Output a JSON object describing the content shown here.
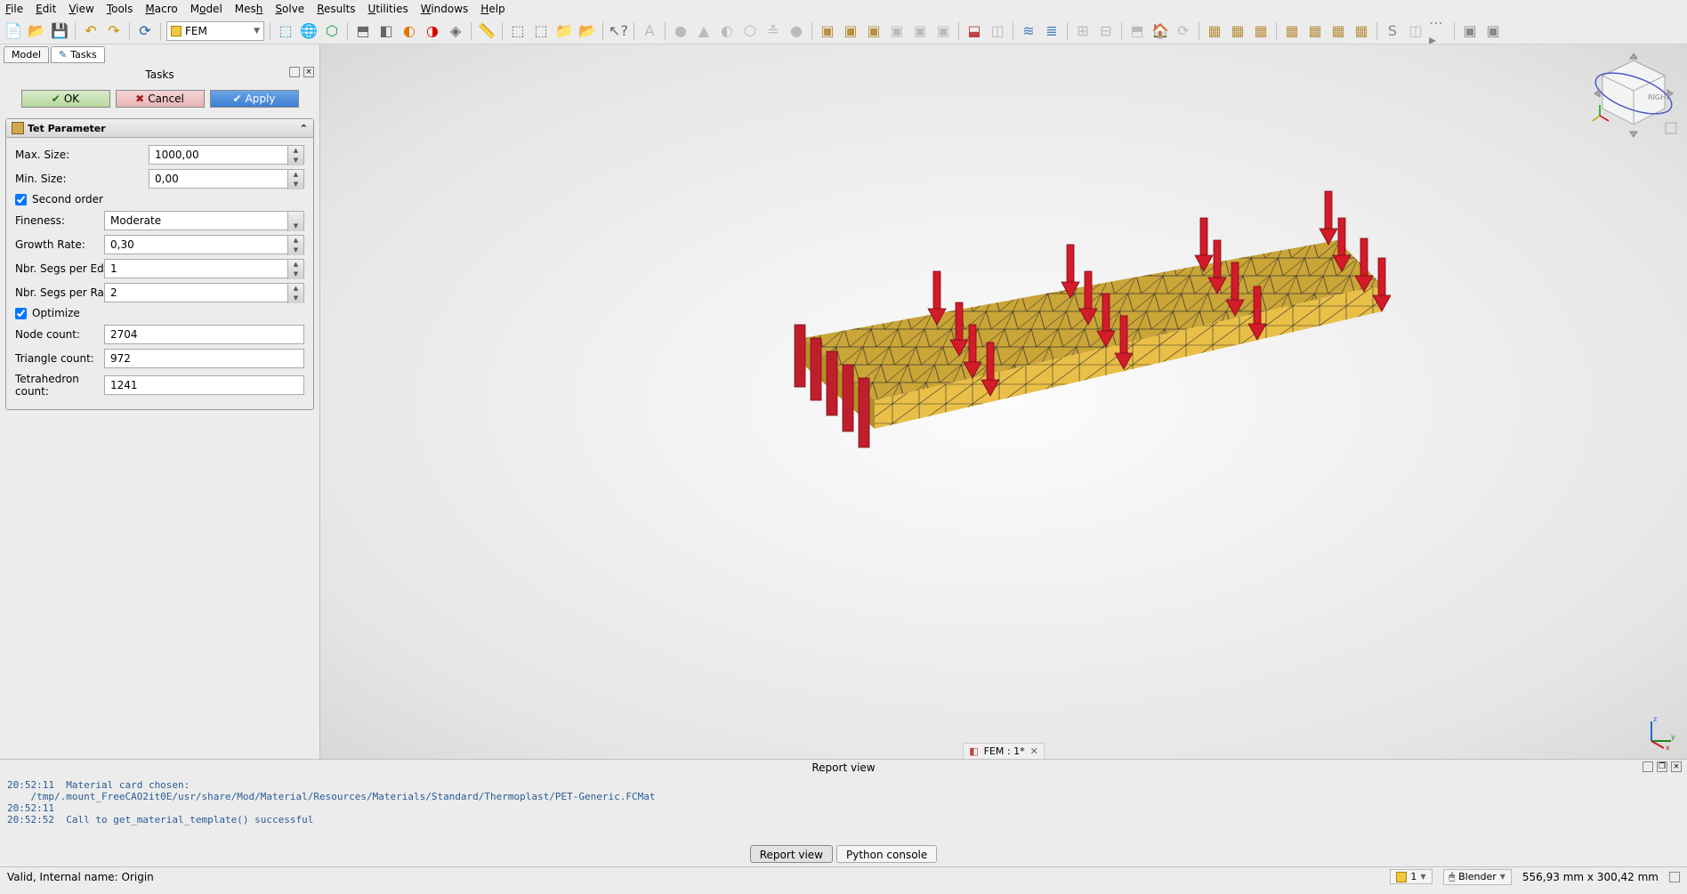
{
  "menu": {
    "items": [
      "File",
      "Edit",
      "View",
      "Tools",
      "Macro",
      "Model",
      "Mesh",
      "Solve",
      "Results",
      "Utilities",
      "Windows",
      "Help"
    ]
  },
  "workbench": {
    "label": "FEM"
  },
  "panel": {
    "tab_model": "Model",
    "tab_tasks": "Tasks",
    "tasks_title": "Tasks",
    "ok": "OK",
    "cancel": "Cancel",
    "apply": "Apply",
    "param_title": "Tet Parameter",
    "max_size_lbl": "Max. Size:",
    "max_size_val": "1000,00",
    "min_size_lbl": "Min. Size:",
    "min_size_val": "0,00",
    "second_order_lbl": "Second order",
    "fineness_lbl": "Fineness:",
    "fineness_val": "Moderate",
    "growth_lbl": "Growth Rate:",
    "growth_val": "0,30",
    "segs_edge_lbl": "Nbr. Segs per Edge:",
    "segs_edge_val": "1",
    "segs_radius_lbl": "Nbr. Segs per Radius:",
    "segs_radius_val": "2",
    "optimize_lbl": "Optimize",
    "node_count_lbl": "Node count:",
    "node_count_val": "2704",
    "triangle_count_lbl": "Triangle count:",
    "triangle_count_val": "972",
    "tetra_count_lbl": "Tetrahedron count:",
    "tetra_count_val": "1241"
  },
  "navcube": {
    "face": "RIGHT"
  },
  "doc_tab": "FEM : 1*",
  "report": {
    "title": "Report view",
    "lines": "20:52:11  Material card chosen:\n    /tmp/.mount_FreeCAO2it0E/usr/share/Mod/Material/Resources/Materials/Standard/Thermoplast/PET-Generic.FCMat\n20:52:11  \n20:52:52  Call to get_material_template() successful",
    "tab_report": "Report view",
    "tab_python": "Python console"
  },
  "status": {
    "left": "Valid, Internal name: Origin",
    "badge": "1",
    "nav_style": "Blender",
    "dims": "556,93 mm x 300,42 mm"
  }
}
